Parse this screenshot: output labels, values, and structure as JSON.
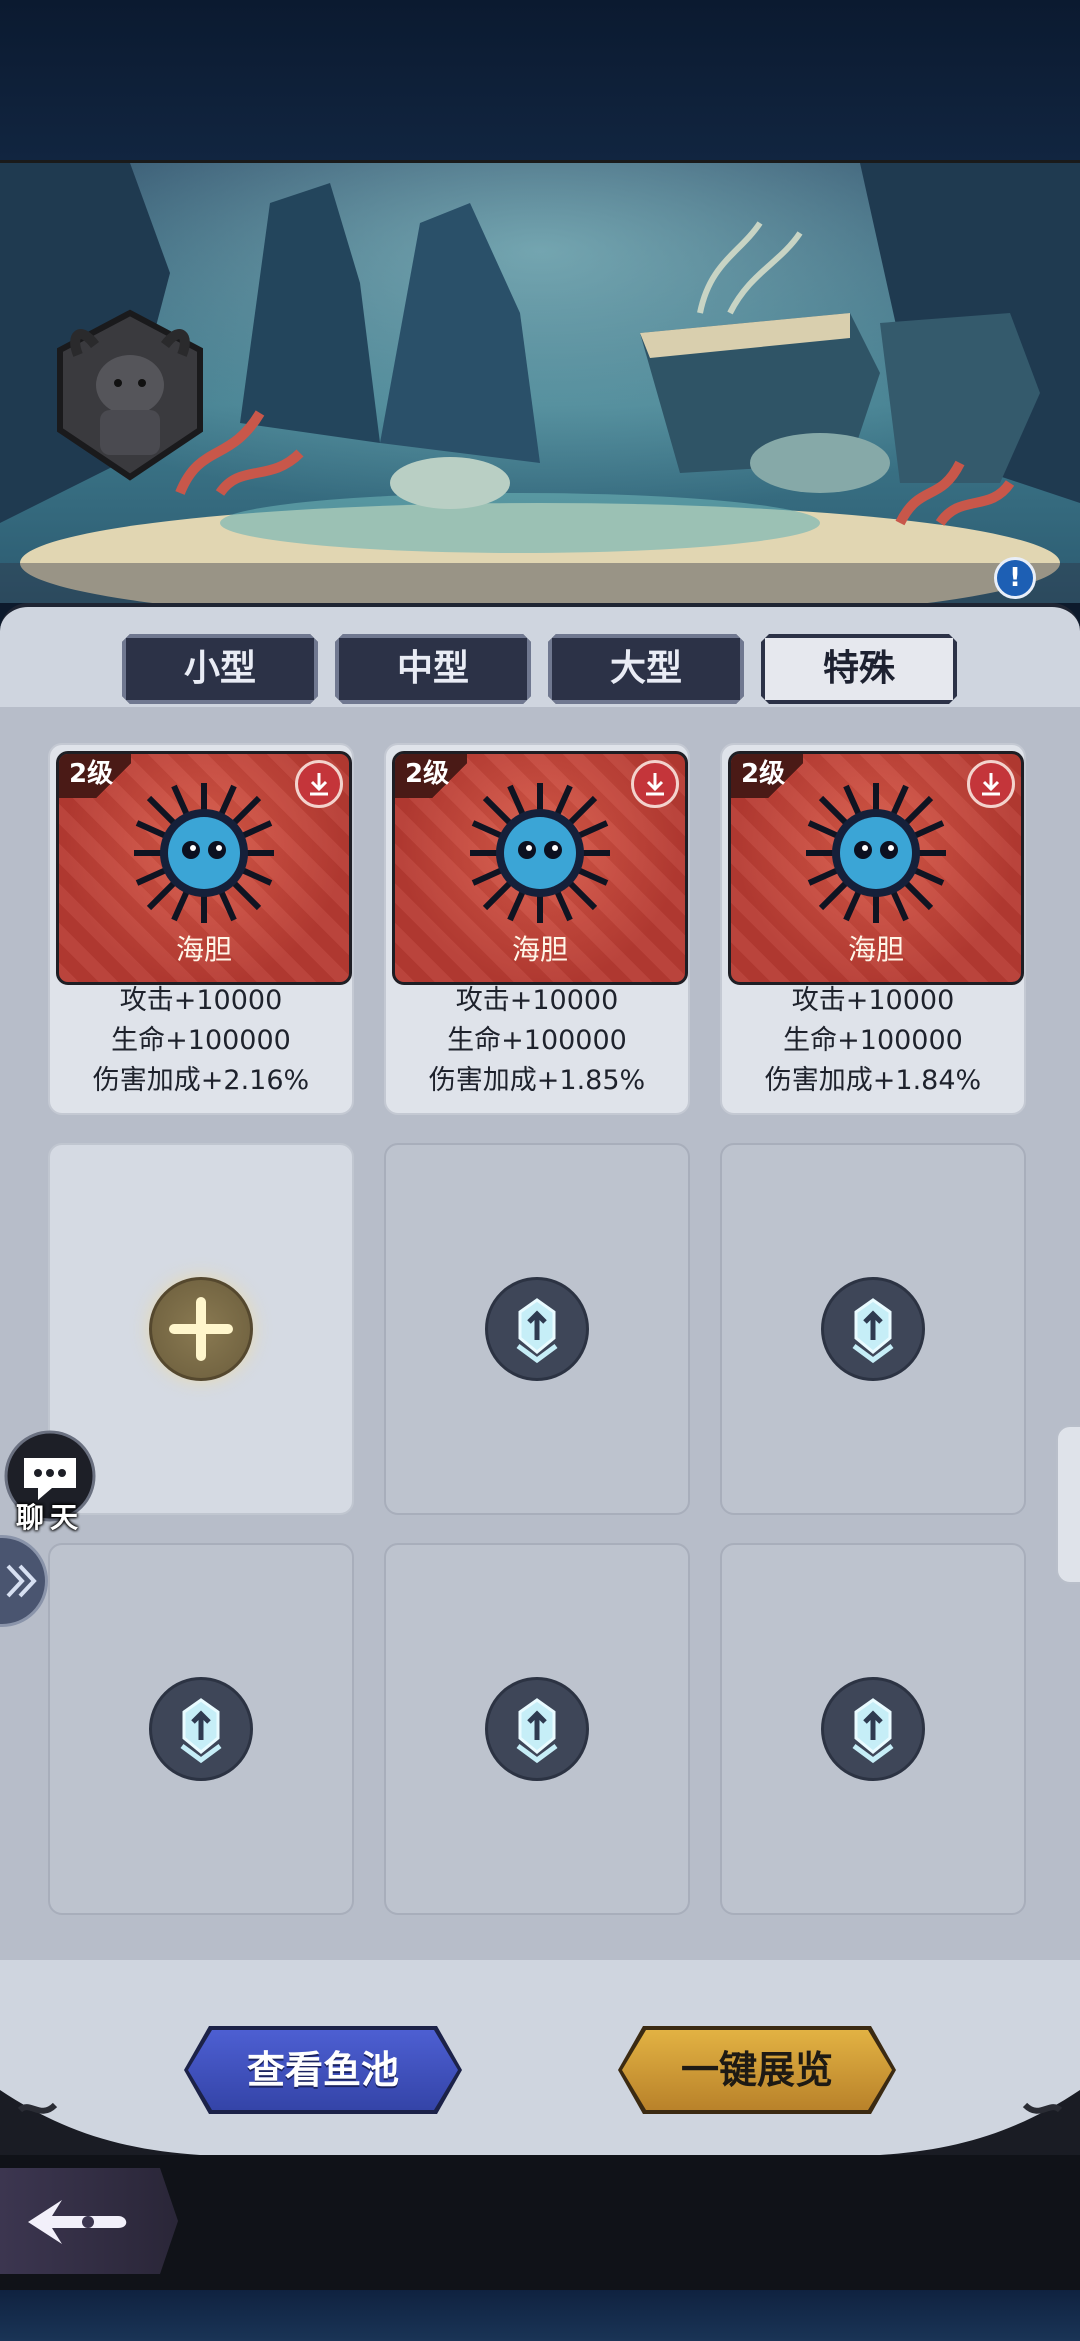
{
  "tabs": [
    {
      "label": "小型",
      "active": false
    },
    {
      "label": "中型",
      "active": false
    },
    {
      "label": "大型",
      "active": false
    },
    {
      "label": "特殊",
      "active": true
    }
  ],
  "fish_slots": [
    {
      "level": "2级",
      "name": "海胆",
      "attack": "攻击+10000",
      "hp": "生命+100000",
      "damage_bonus": "伤害加成+2.16%"
    },
    {
      "level": "2级",
      "name": "海胆",
      "attack": "攻击+10000",
      "hp": "生命+100000",
      "damage_bonus": "伤害加成+1.85%"
    },
    {
      "level": "2级",
      "name": "海胆",
      "attack": "攻击+10000",
      "hp": "生命+100000",
      "damage_bonus": "伤害加成+1.84%"
    }
  ],
  "empty_slots": [
    {
      "state": "add",
      "icon": "plus-icon"
    },
    {
      "state": "locked",
      "icon": "lock-upgrade-icon"
    },
    {
      "state": "locked",
      "icon": "lock-upgrade-icon"
    },
    {
      "state": "locked",
      "icon": "lock-upgrade-icon"
    },
    {
      "state": "locked",
      "icon": "lock-upgrade-icon"
    },
    {
      "state": "locked",
      "icon": "lock-upgrade-icon"
    }
  ],
  "chat": {
    "label": "聊天"
  },
  "buttons": {
    "view_pool": "查看鱼池",
    "one_click_display": "一键展览"
  },
  "info_icon": "!",
  "colors": {
    "card_red": "#c9443a",
    "tab_dark": "#2c3247",
    "pool_button": "#4353c0",
    "display_button": "#d7a43b"
  }
}
